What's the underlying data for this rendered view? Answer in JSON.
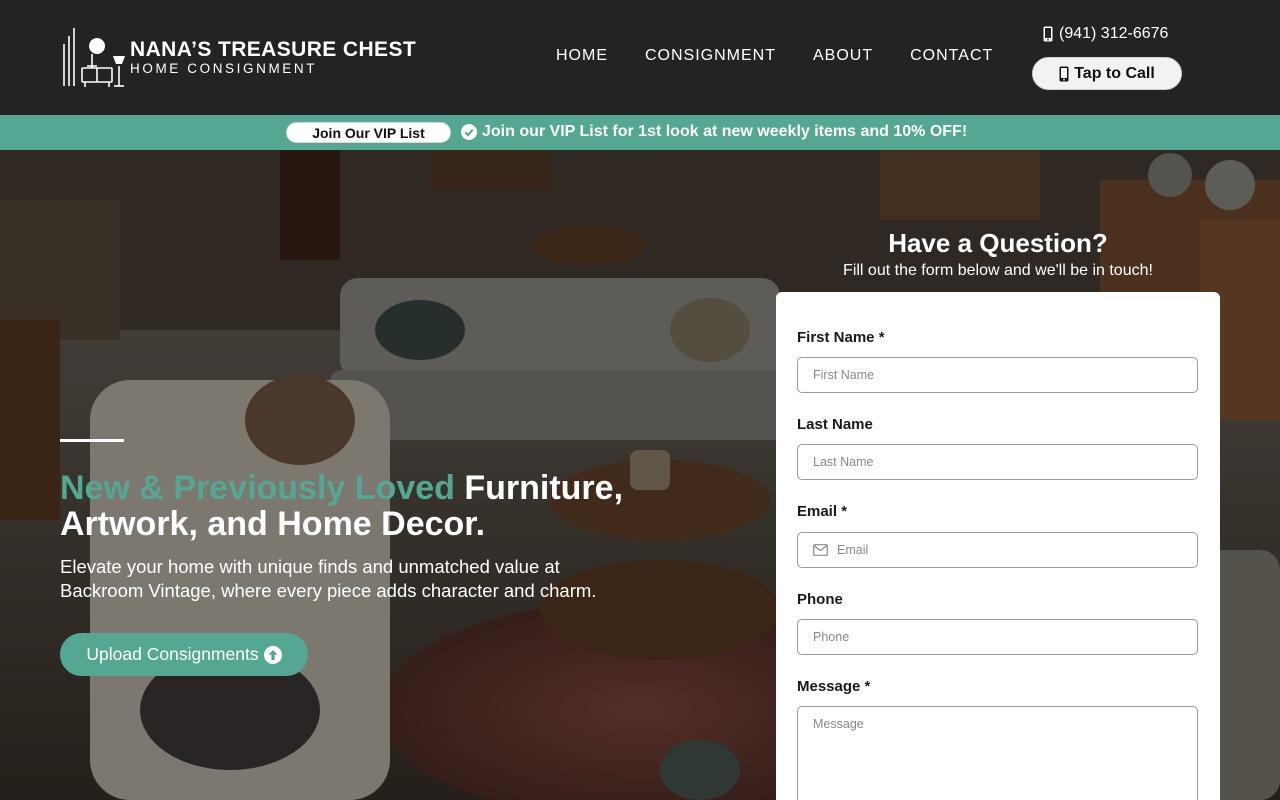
{
  "brand": {
    "title": "NANA’S TREASURE CHEST",
    "subtitle": "HOME CONSIGNMENT"
  },
  "nav": {
    "items": [
      "HOME",
      "CONSIGNMENT",
      "ABOUT",
      "CONTACT"
    ]
  },
  "contact": {
    "phone": "(941) 312-6676",
    "call_label": "Tap to Call"
  },
  "vip": {
    "button_label": "Join Our VIP List",
    "message": "Join our VIP List for 1st look at new weekly items and 10% OFF!"
  },
  "hero": {
    "headline_accent": "New & Previously Loved",
    "headline_rest_1": " Furniture,",
    "headline_rest_2": "Artwork, and Home Decor.",
    "subtext": "Elevate your home with unique finds and unmatched value at Backroom Vintage, where every piece adds character and charm.",
    "cta_label": "Upload Consignments"
  },
  "form": {
    "title": "Have a Question?",
    "subtitle": "Fill out the form below and we'll be in touch!",
    "fields": [
      {
        "label": "First Name",
        "required": "*",
        "placeholder": "First Name"
      },
      {
        "label": "Last Name",
        "required": "",
        "placeholder": "Last Name"
      },
      {
        "label": "Email",
        "required": "*",
        "placeholder": "Email"
      },
      {
        "label": "Phone",
        "required": "",
        "placeholder": "Phone"
      },
      {
        "label": "Message",
        "required": "*",
        "placeholder": "Message"
      }
    ]
  },
  "colors": {
    "accent": "#54a893",
    "header_bg": "#232323"
  },
  "icons": [
    "mobile-phone-icon",
    "check-circle-icon",
    "arrow-up-circle-icon",
    "envelope-icon"
  ]
}
